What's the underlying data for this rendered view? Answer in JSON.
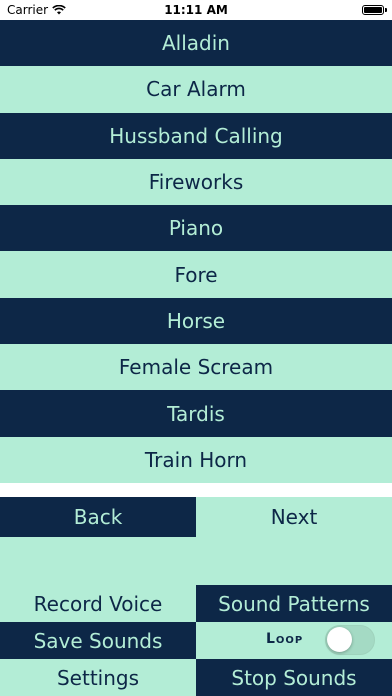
{
  "status_bar": {
    "carrier": "Carrier",
    "time": "11:11 AM"
  },
  "sounds": [
    {
      "label": "Alladin"
    },
    {
      "label": "Car Alarm"
    },
    {
      "label": "Hussband Calling"
    },
    {
      "label": "Fireworks"
    },
    {
      "label": "Piano"
    },
    {
      "label": "Fore"
    },
    {
      "label": "Horse"
    },
    {
      "label": "Female Scream"
    },
    {
      "label": "Tardis"
    },
    {
      "label": "Train Horn"
    }
  ],
  "pagination": {
    "back_label": "Back",
    "next_label": "Next"
  },
  "controls": {
    "record_voice_label": "Record Voice",
    "sound_patterns_label": "Sound Patterns",
    "save_sounds_label": "Save Sounds",
    "loop_label": "Loop",
    "loop_on": false,
    "settings_label": "Settings",
    "stop_sounds_label": "Stop Sounds"
  },
  "colors": {
    "dark": "#0d2747",
    "light": "#b3edd6"
  }
}
